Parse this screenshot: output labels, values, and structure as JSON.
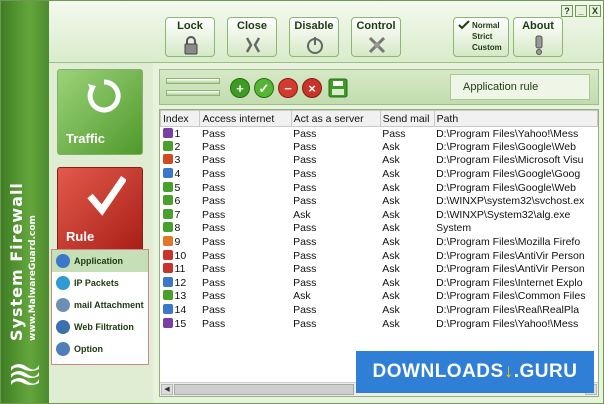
{
  "brand": {
    "title": "System Firewall",
    "url": "www.MalwareGuard.com"
  },
  "window_controls": [
    "?",
    "_",
    "X"
  ],
  "toolbar": {
    "lock": "Lock",
    "close": "Close",
    "disable": "Disable",
    "control": "Control",
    "about": "About",
    "mode_options": [
      "Normal",
      "Strict",
      "Custom"
    ],
    "mode_selected": "Normal"
  },
  "nav": {
    "traffic": "Traffic",
    "rule": "Rule",
    "subitems": [
      "Application",
      "IP Packets",
      "mail Attachment",
      "Web Filtration",
      "Option"
    ],
    "active_subitem": "Application"
  },
  "main": {
    "section_title": "Application rule"
  },
  "table": {
    "columns": [
      "Index",
      "Access internet",
      "Act as a server",
      "Send mail",
      "Path"
    ],
    "rows": [
      [
        "1",
        "Pass",
        "Pass",
        "Pass",
        "D:\\Program Files\\Yahoo!\\Mess"
      ],
      [
        "2",
        "Pass",
        "Pass",
        "Ask",
        "D:\\Program Files\\Google\\Web"
      ],
      [
        "3",
        "Pass",
        "Pass",
        "Ask",
        "D:\\Program Files\\Microsoft Visu"
      ],
      [
        "4",
        "Pass",
        "Pass",
        "Ask",
        "D:\\Program Files\\Google\\Goog"
      ],
      [
        "5",
        "Pass",
        "Pass",
        "Ask",
        "D:\\Program Files\\Google\\Web"
      ],
      [
        "6",
        "Pass",
        "Pass",
        "Ask",
        "D:\\WINXP\\system32\\svchost.ex"
      ],
      [
        "7",
        "Pass",
        "Ask",
        "Ask",
        "D:\\WINXP\\System32\\alg.exe"
      ],
      [
        "8",
        "Pass",
        "Pass",
        "Ask",
        "System"
      ],
      [
        "9",
        "Pass",
        "Pass",
        "Ask",
        "D:\\Program Files\\Mozilla Firefo"
      ],
      [
        "10",
        "Pass",
        "Pass",
        "Ask",
        "D:\\Program Files\\AntiVir Person"
      ],
      [
        "11",
        "Pass",
        "Pass",
        "Ask",
        "D:\\Program Files\\AntiVir Person"
      ],
      [
        "12",
        "Pass",
        "Pass",
        "Ask",
        "D:\\Program Files\\Internet Explo"
      ],
      [
        "13",
        "Pass",
        "Ask",
        "Ask",
        "D:\\Program Files\\Common Files"
      ],
      [
        "14",
        "Pass",
        "Pass",
        "Ask",
        "D:\\Program Files\\Real\\RealPla"
      ],
      [
        "15",
        "Pass",
        "Pass",
        "Ask",
        "D:\\Program Files\\Yahoo!\\Mess"
      ]
    ],
    "row_icon_colors": [
      "#7a3fa3",
      "#4aa02c",
      "#d24a1f",
      "#3b78c9",
      "#4aa02c",
      "#4aa02c",
      "#4aa02c",
      "#4aa02c",
      "#e0782a",
      "#c8332b",
      "#c8332b",
      "#3b78c9",
      "#4aa02c",
      "#3b78c9",
      "#7a3fa3"
    ]
  },
  "watermark": {
    "text": "DOWNLOADS",
    "dot": "↓",
    "suffix": ".GURU"
  },
  "colors": {
    "accent_green": "#4f9a2b",
    "rule_red": "#c8332b"
  }
}
